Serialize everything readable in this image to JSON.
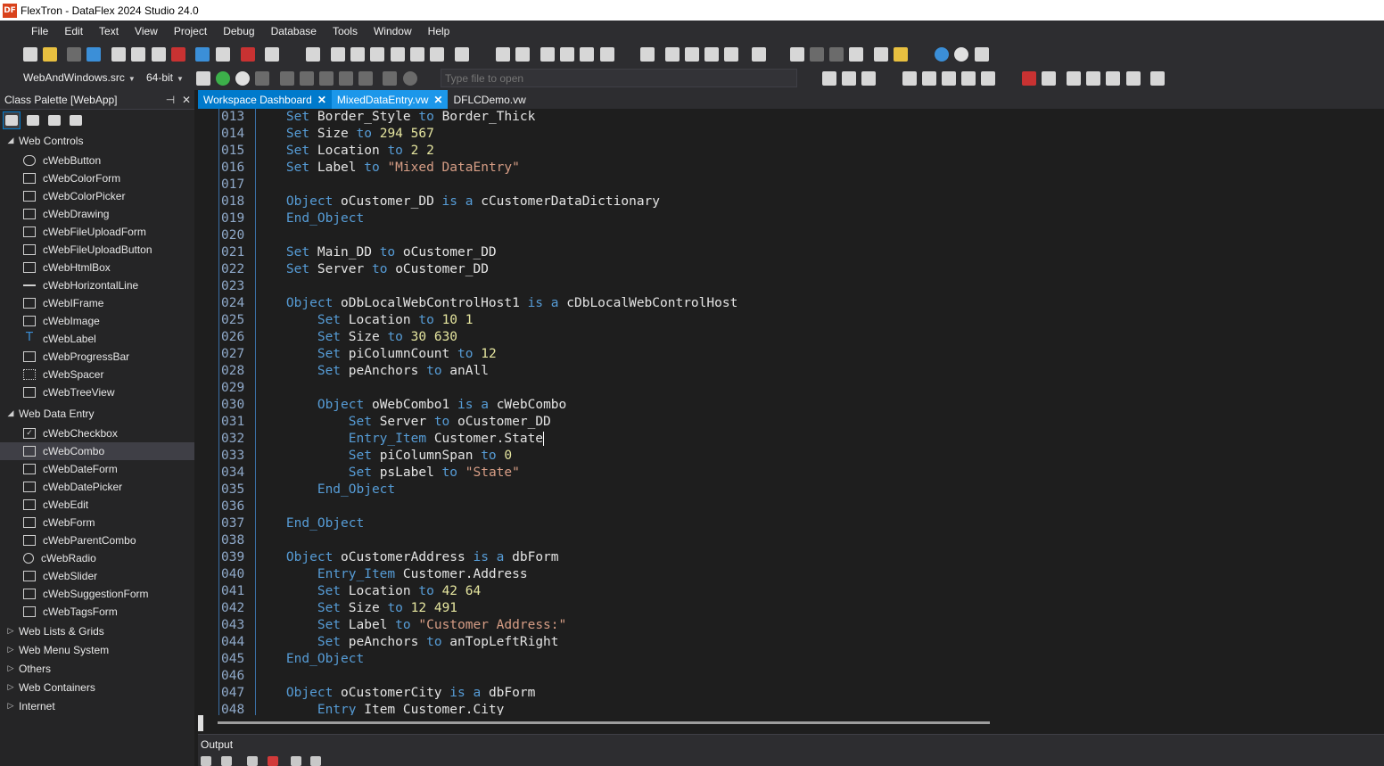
{
  "window": {
    "title": "FlexTron - DataFlex 2024 Studio 24.0",
    "app_icon": "DF"
  },
  "menu": [
    "File",
    "Edit",
    "Text",
    "View",
    "Project",
    "Debug",
    "Database",
    "Tools",
    "Window",
    "Help"
  ],
  "toolbar": {
    "project_select": "WebAndWindows.src",
    "platform_select": "64-bit",
    "file_open_placeholder": "Type file to open"
  },
  "palette": {
    "title": "Class Palette [WebApp]",
    "pin_icon": "⊣",
    "close_icon": "✕",
    "groups": [
      {
        "label": "Web Controls",
        "expanded": true,
        "items": [
          "cWebButton",
          "cWebColorForm",
          "cWebColorPicker",
          "cWebDrawing",
          "cWebFileUploadForm",
          "cWebFileUploadButton",
          "cWebHtmlBox",
          "cWebHorizontalLine",
          "cWebIFrame",
          "cWebImage",
          "cWebLabel",
          "cWebProgressBar",
          "cWebSpacer",
          "cWebTreeView"
        ]
      },
      {
        "label": "Web Data Entry",
        "expanded": true,
        "items": [
          "cWebCheckbox",
          "cWebCombo",
          "cWebDateForm",
          "cWebDatePicker",
          "cWebEdit",
          "cWebForm",
          "cWebParentCombo",
          "cWebRadio",
          "cWebSlider",
          "cWebSuggestionForm",
          "cWebTagsForm"
        ]
      },
      {
        "label": "Web Lists & Grids",
        "expanded": false,
        "items": []
      },
      {
        "label": "Web Menu System",
        "expanded": false,
        "items": []
      },
      {
        "label": "Others",
        "expanded": false,
        "items": []
      },
      {
        "label": "Web Containers",
        "expanded": false,
        "items": []
      },
      {
        "label": "Internet",
        "expanded": false,
        "items": []
      }
    ],
    "selected_item": "cWebCombo"
  },
  "tabs": [
    {
      "label": "Workspace Dashboard",
      "state": "active",
      "closable": true
    },
    {
      "label": "MixedDataEntry.vw",
      "state": "open",
      "closable": true
    },
    {
      "label": "DFLCDemo.vw",
      "state": "inactive",
      "closable": false
    }
  ],
  "editor": {
    "lines": [
      {
        "n": "013",
        "t": "    Set Border_Style to Border_Thick"
      },
      {
        "n": "014",
        "t": "    Set Size to 294 567"
      },
      {
        "n": "015",
        "t": "    Set Location to 2 2"
      },
      {
        "n": "016",
        "t": "    Set Label to \"Mixed DataEntry\""
      },
      {
        "n": "017",
        "t": ""
      },
      {
        "n": "018",
        "t": "    Object oCustomer_DD is a cCustomerDataDictionary"
      },
      {
        "n": "019",
        "t": "    End_Object"
      },
      {
        "n": "020",
        "t": ""
      },
      {
        "n": "021",
        "t": "    Set Main_DD to oCustomer_DD"
      },
      {
        "n": "022",
        "t": "    Set Server to oCustomer_DD"
      },
      {
        "n": "023",
        "t": ""
      },
      {
        "n": "024",
        "t": "    Object oDbLocalWebControlHost1 is a cDbLocalWebControlHost"
      },
      {
        "n": "025",
        "t": "        Set Location to 10 1"
      },
      {
        "n": "026",
        "t": "        Set Size to 30 630"
      },
      {
        "n": "027",
        "t": "        Set piColumnCount to 12"
      },
      {
        "n": "028",
        "t": "        Set peAnchors to anAll"
      },
      {
        "n": "029",
        "t": ""
      },
      {
        "n": "030",
        "t": "        Object oWebCombo1 is a cWebCombo"
      },
      {
        "n": "031",
        "t": "            Set Server to oCustomer_DD"
      },
      {
        "n": "032",
        "t": "            Entry_Item Customer.State"
      },
      {
        "n": "033",
        "t": "            Set piColumnSpan to 0"
      },
      {
        "n": "034",
        "t": "            Set psLabel to \"State\""
      },
      {
        "n": "035",
        "t": "        End_Object"
      },
      {
        "n": "036",
        "t": ""
      },
      {
        "n": "037",
        "t": "    End_Object"
      },
      {
        "n": "038",
        "t": ""
      },
      {
        "n": "039",
        "t": "    Object oCustomerAddress is a dbForm"
      },
      {
        "n": "040",
        "t": "        Entry_Item Customer.Address"
      },
      {
        "n": "041",
        "t": "        Set Location to 42 64"
      },
      {
        "n": "042",
        "t": "        Set Size to 12 491"
      },
      {
        "n": "043",
        "t": "        Set Label to \"Customer Address:\""
      },
      {
        "n": "044",
        "t": "        Set peAnchors to anTopLeftRight"
      },
      {
        "n": "045",
        "t": "    End_Object"
      },
      {
        "n": "046",
        "t": ""
      },
      {
        "n": "047",
        "t": "    Object oCustomerCity is a dbForm"
      },
      {
        "n": "048",
        "t": "        Entry Item Customer.City"
      }
    ],
    "cursor_line": "032"
  },
  "output": {
    "title": "Output"
  },
  "colors": {
    "accent": "#007acc",
    "keyword": "#569cd6",
    "string": "#d69d85",
    "number": "#e5e59f",
    "identifier": "#e4e4e4",
    "line_number": "#8fa9c9"
  }
}
